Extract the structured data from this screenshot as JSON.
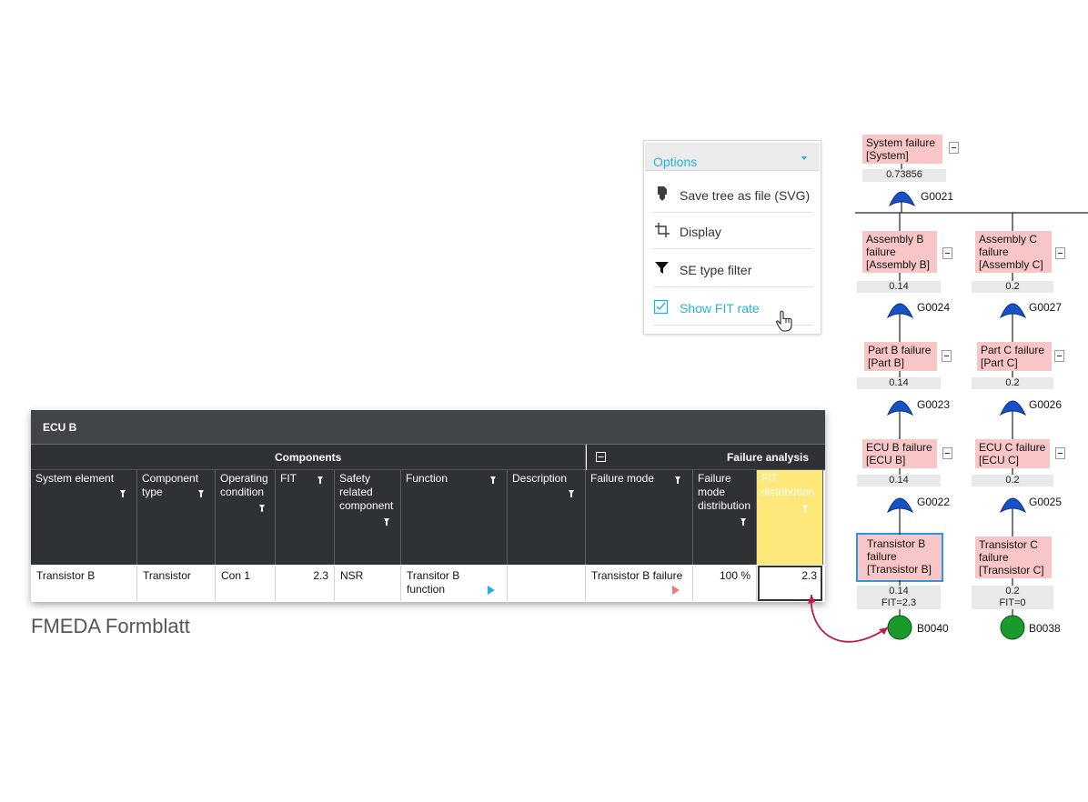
{
  "options": {
    "title": "Options",
    "items": [
      {
        "label": "Save tree as file (SVG)",
        "icon": "file-save-icon"
      },
      {
        "label": "Display",
        "icon": "display-crop-icon"
      },
      {
        "label": "SE type filter",
        "icon": "filter-icon"
      },
      {
        "label": "Show FIT rate",
        "icon": "checkbox-checked-icon",
        "checked": true
      }
    ]
  },
  "fault_tree": {
    "root": {
      "line1": "System failure",
      "line2": "[System]",
      "value": "0.73856",
      "gate": "G0021"
    },
    "assembly_b": {
      "line1": "Assembly B",
      "line2": "failure",
      "line3": "[Assembly B]",
      "value": "0.14",
      "gate": "G0024"
    },
    "assembly_c": {
      "line1": "Assembly C",
      "line2": "failure",
      "line3": "[Assembly C]",
      "value": "0.2",
      "gate": "G0027"
    },
    "part_b": {
      "line1": "Part B failure",
      "line2": "[Part B]",
      "value": "0.14",
      "gate": "G0023"
    },
    "part_c": {
      "line1": "Part C failure",
      "line2": "[Part C]",
      "value": "0.2",
      "gate": "G0026"
    },
    "ecu_b": {
      "line1": "ECU B failure",
      "line2": "[ECU B]",
      "value": "0.14",
      "gate": "G0022"
    },
    "ecu_c": {
      "line1": "ECU C failure",
      "line2": "[ECU C]",
      "value": "0.2",
      "gate": "G0025"
    },
    "transistor_b": {
      "line1": "Transistor B",
      "line2": "failure",
      "line3": "[Transistor B]",
      "value": "0.14",
      "fit": "FIT=2.3",
      "event": "B0040"
    },
    "transistor_c": {
      "line1": "Transistor C",
      "line2": "failure",
      "line3": "[Transistor C]",
      "value": "0.2",
      "fit": "FIT=0",
      "event": "B0038"
    }
  },
  "table": {
    "title": "ECU B",
    "groups": {
      "components": "Components",
      "failure_analysis": "Failure analysis"
    },
    "columns": [
      {
        "l1": "System element",
        "l2": "",
        "l3": "",
        "l4": ""
      },
      {
        "l1": "Component",
        "l2": "type",
        "l3": "",
        "l4": ""
      },
      {
        "l1": "Operating",
        "l2": "condition",
        "l3": "",
        "l4": ""
      },
      {
        "l1": "FIT",
        "l2": "",
        "l3": "",
        "l4": ""
      },
      {
        "l1": "Safety",
        "l2": "related",
        "l3": "component",
        "l4": ""
      },
      {
        "l1": "Function",
        "l2": "",
        "l3": "",
        "l4": ""
      },
      {
        "l1": "Description",
        "l2": "",
        "l3": "",
        "l4": ""
      },
      {
        "l1": "Failure mode",
        "l2": "",
        "l3": "",
        "l4": ""
      },
      {
        "l1": "Failure",
        "l2": "mode",
        "l3": "distribution",
        "l4": ""
      },
      {
        "l1": "FIT",
        "l2": "distribution",
        "l3": "",
        "l4": ""
      }
    ],
    "row": {
      "system_element": "Transistor B",
      "component_type": "Transistor",
      "operating_condition": "Con 1",
      "fit": "2.3",
      "safety_related": "NSR",
      "function_l1": "Transitor B",
      "function_l2": "function",
      "description": "",
      "failure_mode": "Transistor B failure",
      "failure_mode_distribution": "100 %",
      "fit_distribution": "2.3"
    }
  },
  "caption": "FMEDA Formblatt",
  "colors": {
    "accent": "#2ab2d6",
    "highlight": "#ffe87a",
    "event_red": "#f8c6c6",
    "connector": "#c0174d",
    "gate": "#1651c6",
    "basic_event": "#1a9a2a"
  }
}
